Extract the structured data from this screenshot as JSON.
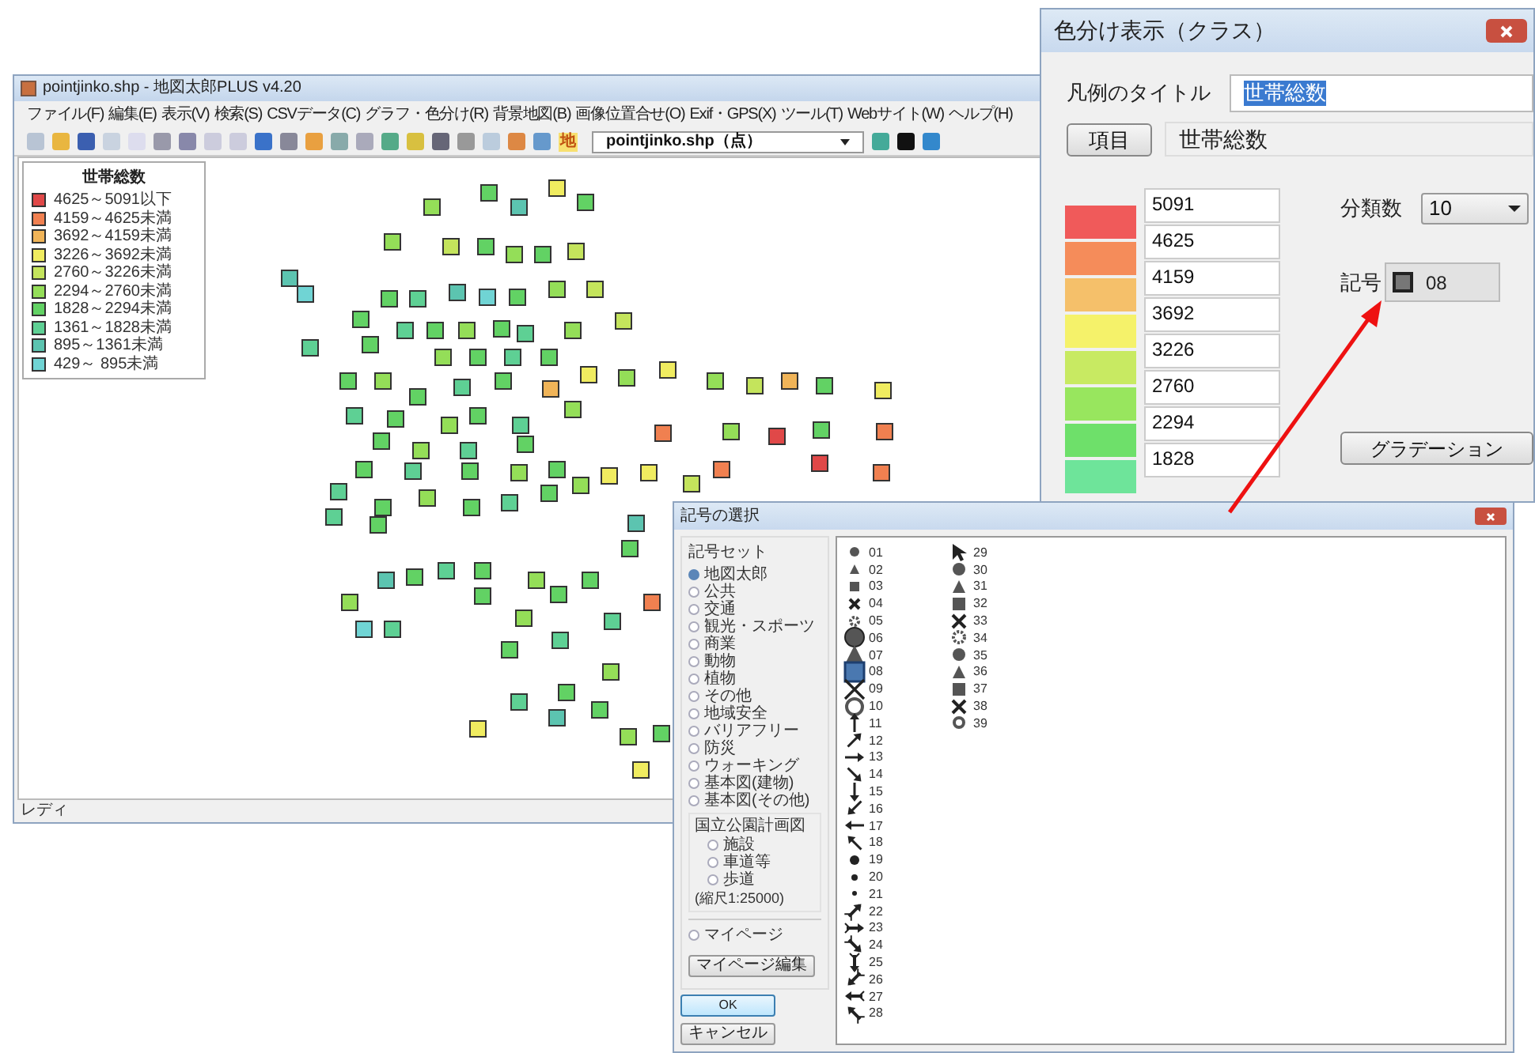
{
  "main_window": {
    "title": "pointjinko.shp - 地図太郎PLUS v4.20",
    "menu": [
      "ファイル(F)",
      "編集(E)",
      "表示(V)",
      "検索(S)",
      "CSVデータ(C)",
      "グラフ・色分け(R)",
      "背景地図(B)",
      "画像位置合せ(O)",
      "Exif・GPS(X)",
      "ツール(T)",
      "Webサイト(W)",
      "ヘルプ(H)"
    ],
    "toolbar": {
      "map_char": "地",
      "layer_select": "pointjinko.shp（点）"
    },
    "legend": {
      "title": "世帯総数",
      "items": [
        {
          "label": "4625～5091以下",
          "color": "#e04848"
        },
        {
          "label": "4159～4625未満",
          "color": "#f08050"
        },
        {
          "label": "3692～4159未満",
          "color": "#f0b458"
        },
        {
          "label": "3226～3692未満",
          "color": "#f0ec60"
        },
        {
          "label": "2760～3226未満",
          "color": "#c4e45c"
        },
        {
          "label": "2294～2760未満",
          "color": "#94de58"
        },
        {
          "label": "1828～2294未満",
          "color": "#62d264"
        },
        {
          "label": "1361～1828未満",
          "color": "#5ed094"
        },
        {
          "label": "895～1361未満",
          "color": "#5cc4b0"
        },
        {
          "label": "429～ 895未満",
          "color": "#70d4d4"
        }
      ]
    },
    "status_bar": "レディ"
  },
  "class_dialog": {
    "title": "色分け表示（クラス）",
    "legend_title_label": "凡例のタイトル",
    "legend_title_value": "世帯総数",
    "item_button": "項目",
    "item_value": "世帯総数",
    "classes": [
      {
        "value": "5091",
        "color": "#f05a5a"
      },
      {
        "value": "4625",
        "color": "#f58c5a"
      },
      {
        "value": "4159",
        "color": "#f5c06a"
      },
      {
        "value": "3692",
        "color": "#f5f26a"
      },
      {
        "value": "3226",
        "color": "#c8ea62"
      },
      {
        "value": "2760",
        "color": "#98e65e"
      },
      {
        "value": "2294",
        "color": "#6ee06a"
      },
      {
        "value": "1828",
        "color": "#6ee49a"
      }
    ],
    "class_count_label": "分類数",
    "class_count": "10",
    "symbol_label": "記号",
    "symbol_button": "08",
    "gradation_button": "グラデーション"
  },
  "symbol_dialog": {
    "title": "記号の選択",
    "set_label": "記号セット",
    "sets": [
      {
        "label": "地図太郎",
        "selected": true
      },
      {
        "label": "公共",
        "selected": false
      },
      {
        "label": "交通",
        "selected": false
      },
      {
        "label": "観光・スポーツ",
        "selected": false
      },
      {
        "label": "商業",
        "selected": false
      },
      {
        "label": "動物",
        "selected": false
      },
      {
        "label": "植物",
        "selected": false
      },
      {
        "label": "その他",
        "selected": false
      },
      {
        "label": "地域安全",
        "selected": false
      },
      {
        "label": "バリアフリー",
        "selected": false
      },
      {
        "label": "防災",
        "selected": false
      },
      {
        "label": "ウォーキング",
        "selected": false
      },
      {
        "label": "基本図(建物)",
        "selected": false
      },
      {
        "label": "基本図(その他)",
        "selected": false
      }
    ],
    "park_group": {
      "title": "国立公園計画図",
      "items": [
        {
          "label": "施設",
          "selected": false
        },
        {
          "label": "車道等",
          "selected": false
        },
        {
          "label": "歩道",
          "selected": false
        }
      ],
      "note": "(縮尺1:25000)"
    },
    "mypage": {
      "label": "マイページ",
      "selected": false
    },
    "mypage_edit": "マイページ編集",
    "ok": "OK",
    "cancel": "キャンセル",
    "symbols": [
      {
        "label": "01",
        "kind": "smallcircle",
        "selected": false
      },
      {
        "label": "02",
        "kind": "smalltriangle",
        "selected": false
      },
      {
        "label": "03",
        "kind": "smallsquare",
        "selected": false
      },
      {
        "label": "04",
        "kind": "smallcross",
        "selected": false
      },
      {
        "label": "05",
        "kind": "smallgear",
        "selected": false
      },
      {
        "label": "06",
        "kind": "largecircle",
        "selected": false
      },
      {
        "label": "07",
        "kind": "largetriangle",
        "selected": false
      },
      {
        "label": "08",
        "kind": "largesquare",
        "selected": true
      },
      {
        "label": "09",
        "kind": "largecross",
        "selected": false
      },
      {
        "label": "10",
        "kind": "largering",
        "selected": false
      },
      {
        "label": "11",
        "kind": "arrown",
        "selected": false
      },
      {
        "label": "12",
        "kind": "arrowne",
        "selected": false
      },
      {
        "label": "13",
        "kind": "arrowe",
        "selected": false
      },
      {
        "label": "14",
        "kind": "arrowse",
        "selected": false
      },
      {
        "label": "15",
        "kind": "arrows",
        "selected": false
      },
      {
        "label": "16",
        "kind": "arrowsw",
        "selected": false
      },
      {
        "label": "17",
        "kind": "arroww",
        "selected": false
      },
      {
        "label": "18",
        "kind": "arrownw",
        "selected": false
      },
      {
        "label": "19",
        "kind": "largedot",
        "selected": false
      },
      {
        "label": "20",
        "kind": "mediumdot",
        "selected": false
      },
      {
        "label": "21",
        "kind": "smalldot",
        "selected": false
      },
      {
        "label": "22",
        "kind": "fletchne",
        "selected": false
      },
      {
        "label": "23",
        "kind": "fletche",
        "selected": false
      },
      {
        "label": "24",
        "kind": "fletchse",
        "selected": false
      },
      {
        "label": "25",
        "kind": "fletchs",
        "selected": false
      },
      {
        "label": "26",
        "kind": "fletchsw",
        "selected": false
      },
      {
        "label": "27",
        "kind": "fletchw",
        "selected": false
      },
      {
        "label": "28",
        "kind": "fletchnw",
        "selected": false
      },
      {
        "label": "29",
        "kind": "pointer",
        "selected": false
      },
      {
        "label": "30",
        "kind": "mediumcircle",
        "selected": false
      },
      {
        "label": "31",
        "kind": "mediumtriangle",
        "selected": false
      },
      {
        "label": "32",
        "kind": "mediumsquare",
        "selected": false
      },
      {
        "label": "33",
        "kind": "mediumcross",
        "selected": false
      },
      {
        "label": "34",
        "kind": "mediumgear",
        "selected": false
      },
      {
        "label": "35",
        "kind": "mediumcircle",
        "selected": false
      },
      {
        "label": "36",
        "kind": "mediumtriangle",
        "selected": false
      },
      {
        "label": "37",
        "kind": "mediumsquare",
        "selected": false
      },
      {
        "label": "38",
        "kind": "mediumcross",
        "selected": false
      },
      {
        "label": "39",
        "kind": "mediumring",
        "selected": false
      }
    ]
  }
}
